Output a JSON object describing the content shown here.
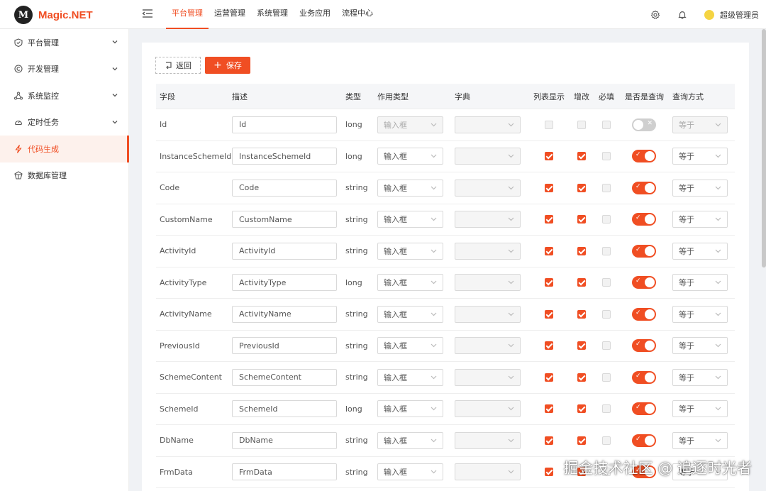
{
  "app": {
    "logo_letter": "M",
    "title": "Magic.NET"
  },
  "topnav": [
    {
      "label": "平台管理",
      "active": true
    },
    {
      "label": "运营管理",
      "active": false
    },
    {
      "label": "系统管理",
      "active": false
    },
    {
      "label": "业务应用",
      "active": false
    },
    {
      "label": "流程中心",
      "active": false
    }
  ],
  "user": {
    "name": "超级管理员"
  },
  "sidebar": {
    "items": [
      {
        "label": "平台管理",
        "icon": "shield-icon",
        "expandable": true,
        "active": false
      },
      {
        "label": "开发管理",
        "icon": "copyright-icon",
        "expandable": true,
        "active": false
      },
      {
        "label": "系统监控",
        "icon": "cluster-icon",
        "expandable": true,
        "active": false
      },
      {
        "label": "定时任务",
        "icon": "dashboard-icon",
        "expandable": true,
        "active": false
      },
      {
        "label": "代码生成",
        "icon": "bolt-icon",
        "expandable": false,
        "active": true
      },
      {
        "label": "数据库管理",
        "icon": "database-icon",
        "expandable": false,
        "active": false
      }
    ]
  },
  "toolbar": {
    "back_label": "返回",
    "save_label": "保存"
  },
  "table": {
    "headers": {
      "field": "字段",
      "desc": "描述",
      "type": "类型",
      "action_type": "作用类型",
      "dict": "字典",
      "list_show": "列表显示",
      "edit": "增改",
      "required": "必填",
      "is_query": "是否是查询",
      "query_mode": "查询方式"
    },
    "rows": [
      {
        "field": "Id",
        "desc": "Id",
        "type": "long",
        "action": "输入框",
        "list": false,
        "edit": false,
        "required": false,
        "query": false,
        "mode": "等于",
        "disabled": true
      },
      {
        "field": "InstanceSchemeId",
        "desc": "InstanceSchemeId",
        "type": "long",
        "action": "输入框",
        "list": true,
        "edit": true,
        "required": false,
        "query": true,
        "mode": "等于",
        "disabled": false
      },
      {
        "field": "Code",
        "desc": "Code",
        "type": "string",
        "action": "输入框",
        "list": true,
        "edit": true,
        "required": false,
        "query": true,
        "mode": "等于",
        "disabled": false
      },
      {
        "field": "CustomName",
        "desc": "CustomName",
        "type": "string",
        "action": "输入框",
        "list": true,
        "edit": true,
        "required": false,
        "query": true,
        "mode": "等于",
        "disabled": false
      },
      {
        "field": "ActivityId",
        "desc": "ActivityId",
        "type": "string",
        "action": "输入框",
        "list": true,
        "edit": true,
        "required": false,
        "query": true,
        "mode": "等于",
        "disabled": false
      },
      {
        "field": "ActivityType",
        "desc": "ActivityType",
        "type": "long",
        "action": "输入框",
        "list": true,
        "edit": true,
        "required": false,
        "query": true,
        "mode": "等于",
        "disabled": false
      },
      {
        "field": "ActivityName",
        "desc": "ActivityName",
        "type": "string",
        "action": "输入框",
        "list": true,
        "edit": true,
        "required": false,
        "query": true,
        "mode": "等于",
        "disabled": false
      },
      {
        "field": "PreviousId",
        "desc": "PreviousId",
        "type": "string",
        "action": "输入框",
        "list": true,
        "edit": true,
        "required": false,
        "query": true,
        "mode": "等于",
        "disabled": false
      },
      {
        "field": "SchemeContent",
        "desc": "SchemeContent",
        "type": "string",
        "action": "输入框",
        "list": true,
        "edit": true,
        "required": false,
        "query": true,
        "mode": "等于",
        "disabled": false
      },
      {
        "field": "SchemeId",
        "desc": "SchemeId",
        "type": "long",
        "action": "输入框",
        "list": true,
        "edit": true,
        "required": false,
        "query": true,
        "mode": "等于",
        "disabled": false
      },
      {
        "field": "DbName",
        "desc": "DbName",
        "type": "string",
        "action": "输入框",
        "list": true,
        "edit": true,
        "required": false,
        "query": true,
        "mode": "等于",
        "disabled": false
      },
      {
        "field": "FrmData",
        "desc": "FrmData",
        "type": "string",
        "action": "输入框",
        "list": true,
        "edit": true,
        "required": false,
        "query": true,
        "mode": "等于",
        "disabled": false
      }
    ]
  },
  "watermark": "掘金技术社区 @ 追逐时光者",
  "colors": {
    "accent": "#f04e23",
    "active_bg": "#fdf1ec"
  }
}
